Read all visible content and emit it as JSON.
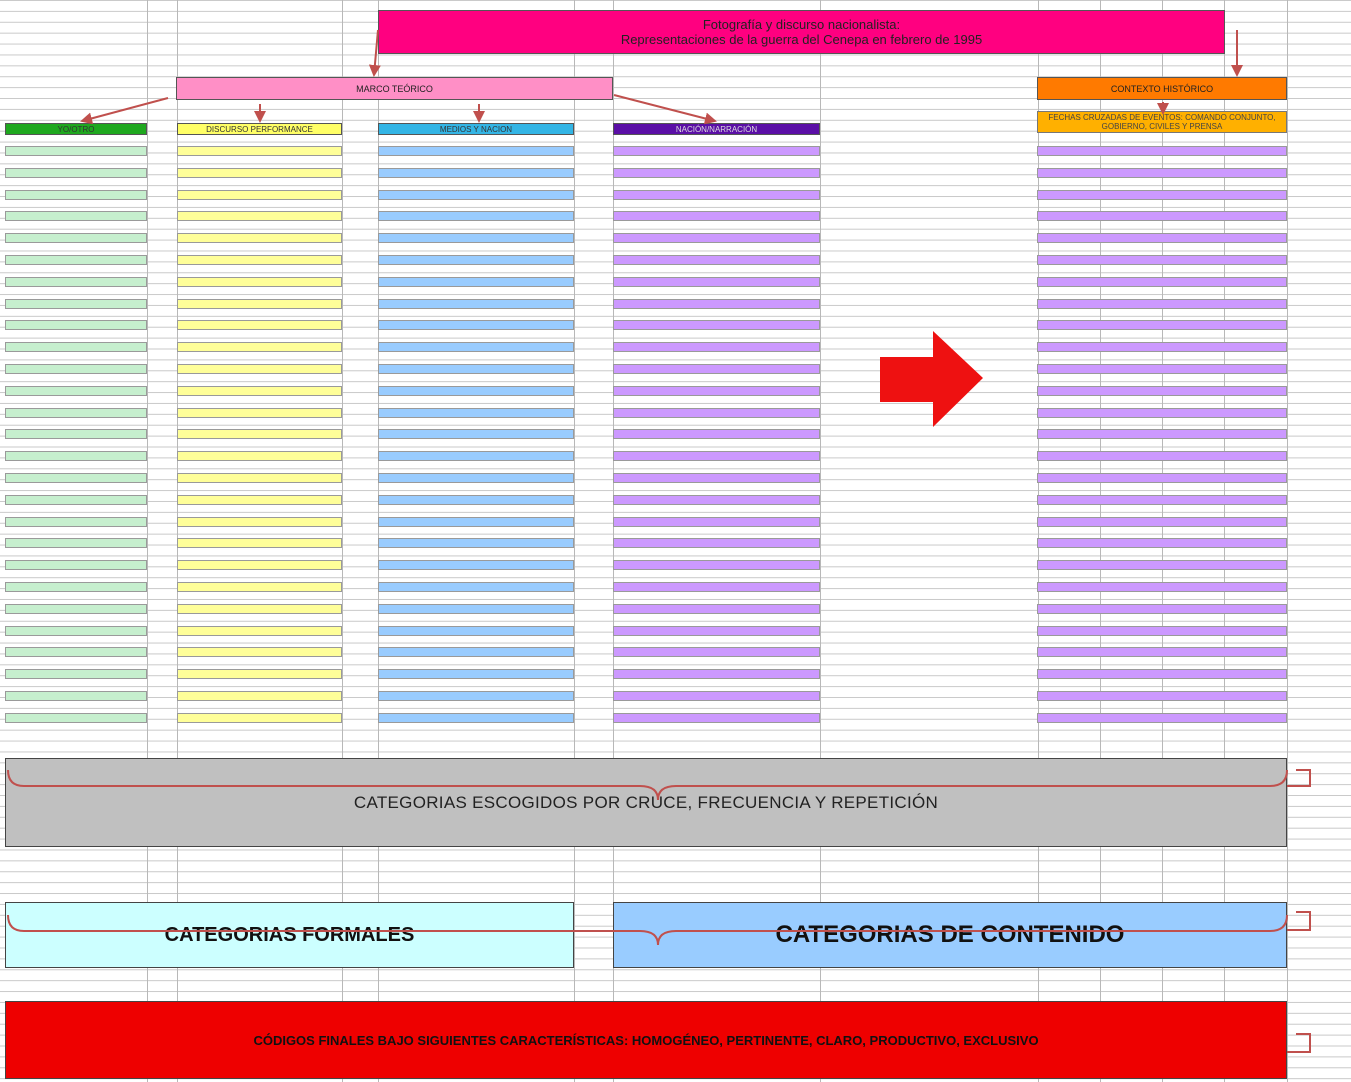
{
  "title": {
    "line1": "Fotografía y discurso nacionalista:",
    "line2": "Representaciones de la guerra del Cenepa en febrero de 1995"
  },
  "marco": {
    "label": "MARCO TEÓRICO"
  },
  "contexto": {
    "label": "CONTEXTO HISTÓRICO",
    "sub_line1": "FECHAS CRUZADAS DE EVENTOS: COMANDO CONJUNTO,",
    "sub_line2": "GOBIERNO, CIVILES Y PRENSA"
  },
  "columns": [
    {
      "label": "YO/OTRO",
      "fill": "#c6efce",
      "header": "#1fa81f"
    },
    {
      "label": "DISCURSO PERFORMANCE",
      "fill": "#ffff99",
      "header": "#ffff66"
    },
    {
      "label": "MEDIOS Y NACION",
      "fill": "#99ccff",
      "header": "#33b5e5"
    },
    {
      "label": "NACIÓN/NARRACIÓN",
      "fill": "#cc99ff",
      "header": "#5b0fa6"
    }
  ],
  "context_strip_fill": "#cc99ff",
  "categorias_cruce": "CATEGORIAS ESCOGIDOS POR CRUCE, FRECUENCIA Y REPETICIÓN",
  "categorias_formales": "CATEGORIAS FORMALES",
  "categorias_contenido": "CATEGORIAS DE CONTENIDO",
  "codigos_finales": "CÓDIGOS FINALES  BAJO SIGUIENTES CARACTERÍSTICAS: HOMOGÉNEO, PERTINENTE, CLARO, PRODUCTIVO, EXCLUSIVO",
  "colors": {
    "title_bg": "#ff0080",
    "marco_bg": "#ff8fc6",
    "contexto_bg": "#ff7a00",
    "arrow_red": "#c0504d",
    "big_arrow": "#ee1111",
    "gray_box": "#c0c0c0",
    "formales_bg": "#ccffff",
    "contenido_bg": "#99ccff",
    "codigos_bg": "#ee0000"
  },
  "strip_rows": 27
}
